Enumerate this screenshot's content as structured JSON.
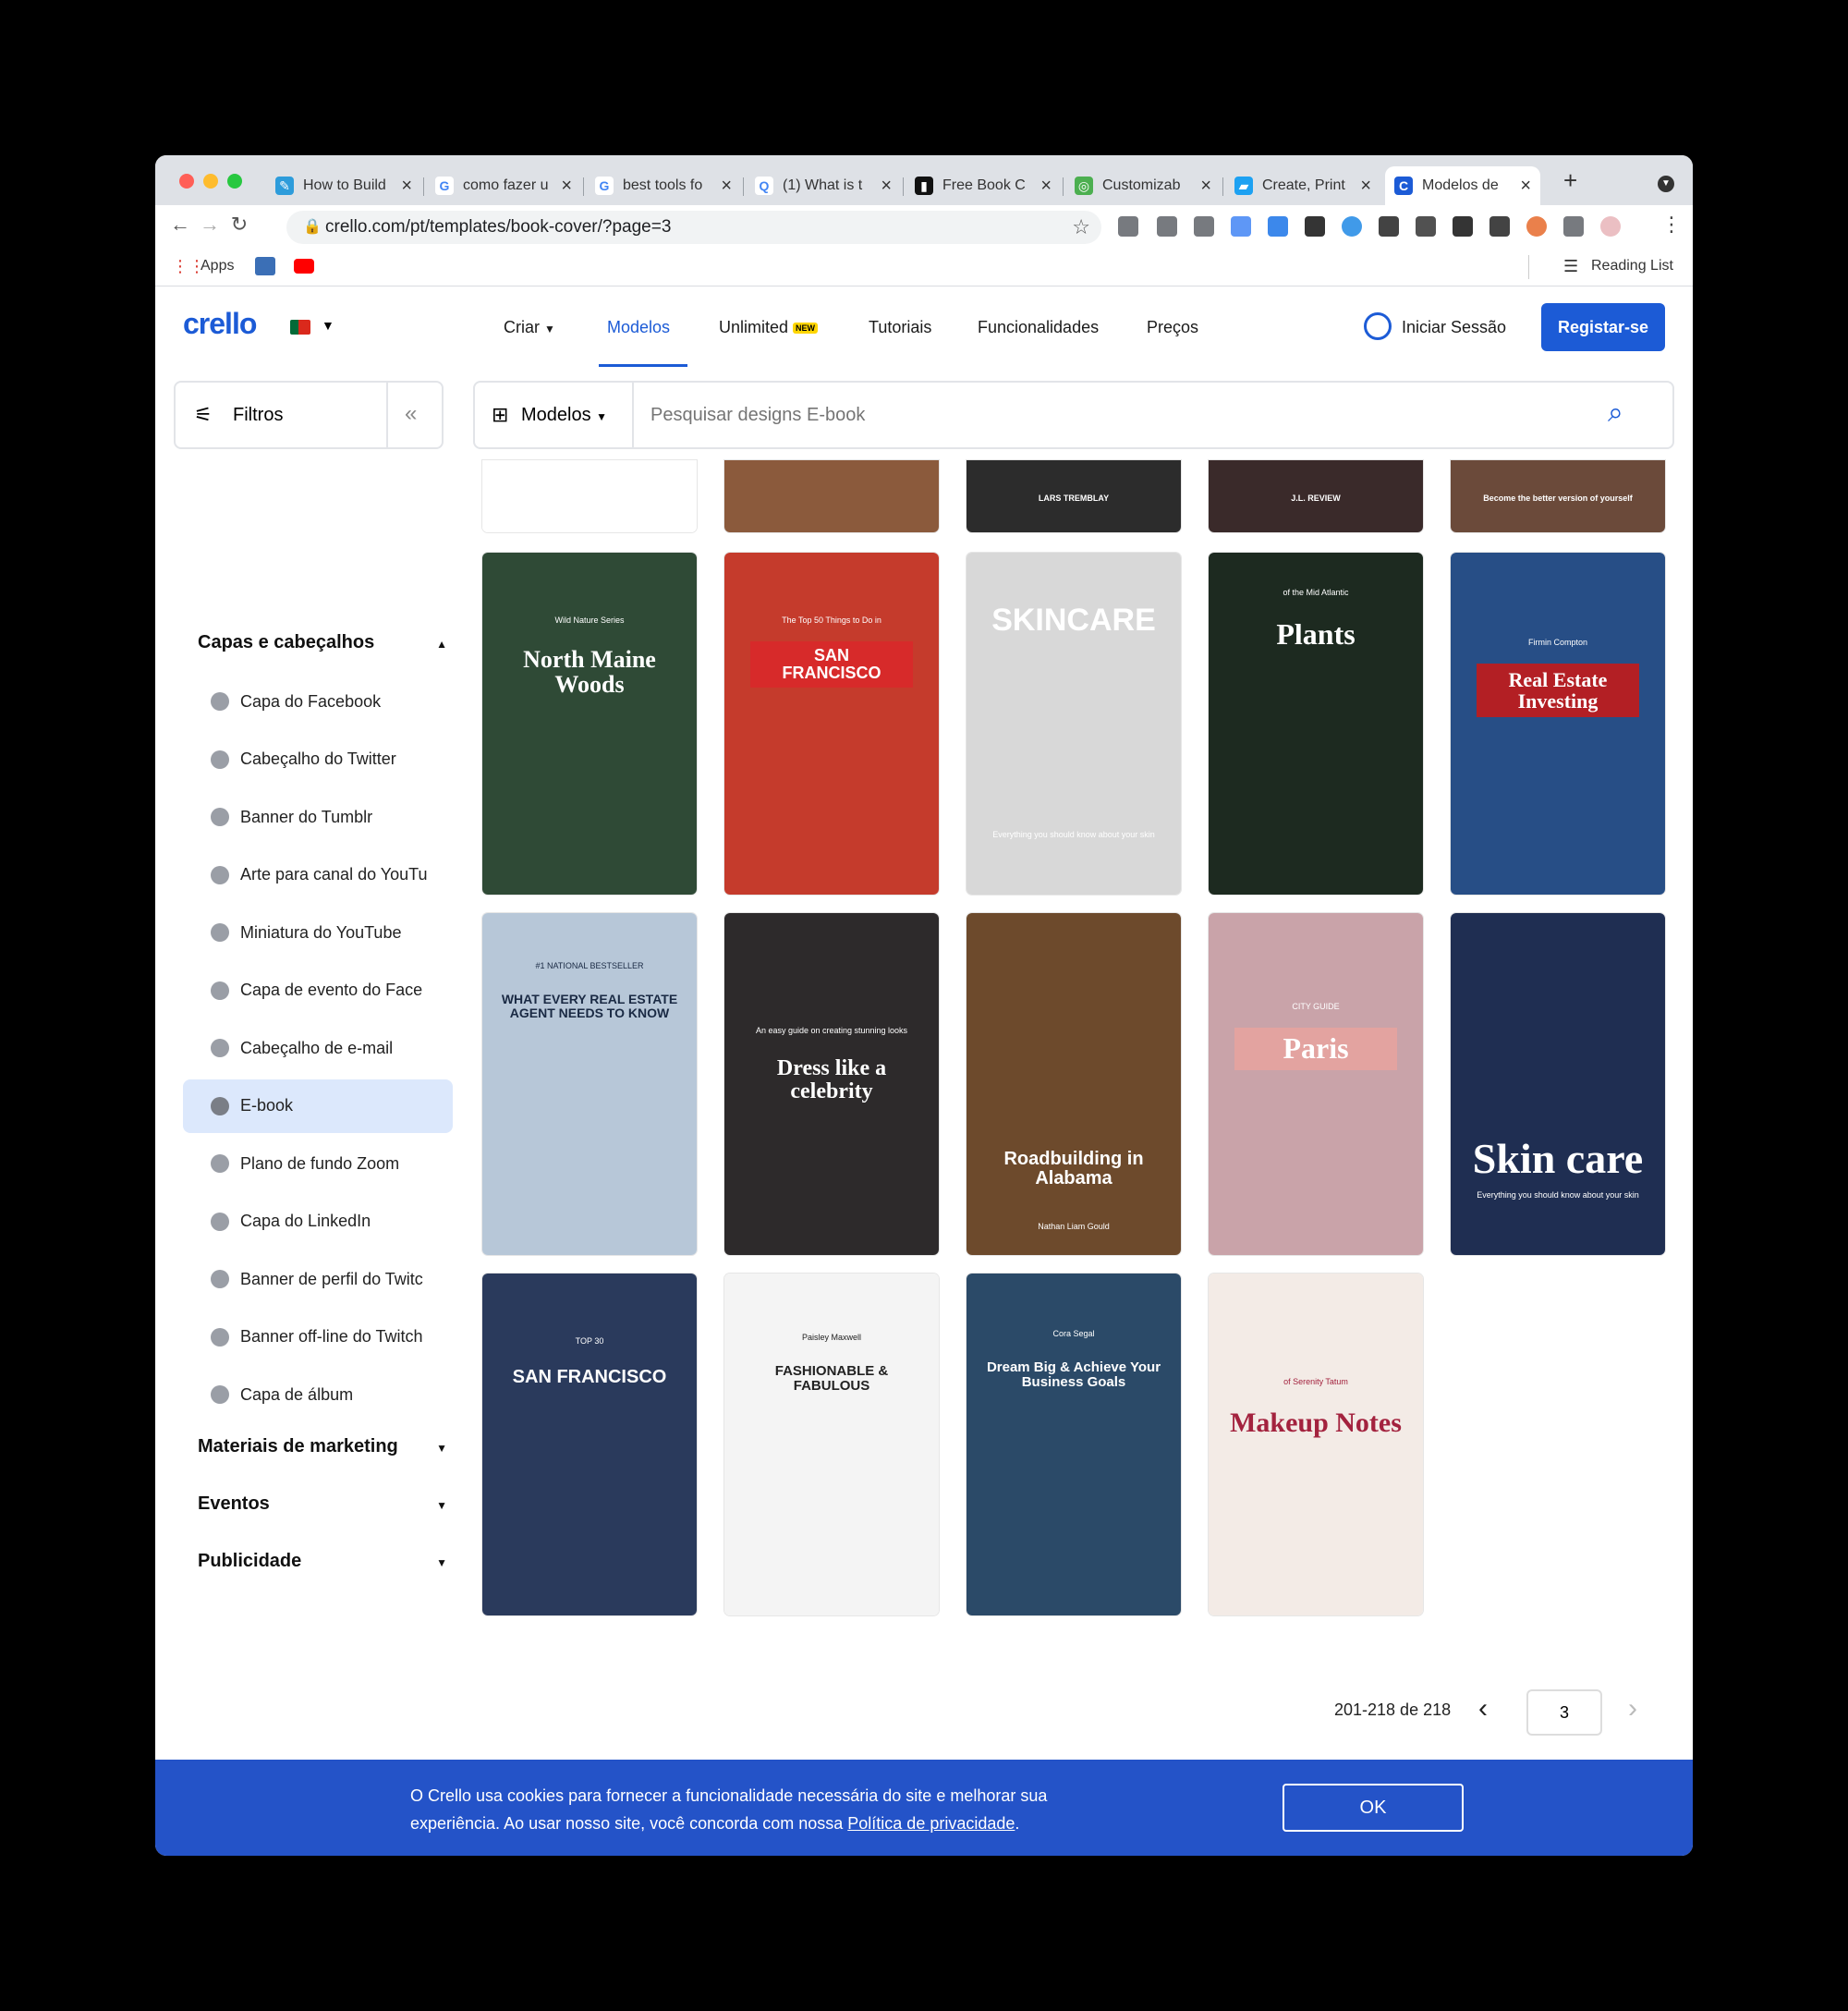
{
  "browser": {
    "tabs": [
      {
        "title": "How to Build",
        "fav": "#2d9cdb",
        "glyph": "✎"
      },
      {
        "title": "como fazer u",
        "fav": "#ffffff",
        "glyph": "G"
      },
      {
        "title": "best tools fo",
        "fav": "#ffffff",
        "glyph": "G"
      },
      {
        "title": "(1) What is t",
        "fav": "#ffffff",
        "glyph": "Q"
      },
      {
        "title": "Free Book C",
        "fav": "#111111",
        "glyph": "▮"
      },
      {
        "title": "Customizab",
        "fav": "#4caf50",
        "glyph": "◎"
      },
      {
        "title": "Create, Print",
        "fav": "#1da1f2",
        "glyph": "▰"
      },
      {
        "title": "Modelos de",
        "fav": "#1c5bd6",
        "glyph": "C"
      }
    ],
    "url": "crello.com/pt/templates/book-cover/?page=3",
    "bookmarks": {
      "apps": "Apps",
      "reading_list": "Reading List"
    }
  },
  "site": {
    "logo": "crello",
    "nav": [
      "Criar",
      "Modelos",
      "Unlimited",
      "Tutoriais",
      "Funcionalidades",
      "Preços"
    ],
    "new_badge": "NEW",
    "login": "Iniciar Sessão",
    "register": "Registar-se"
  },
  "filters": {
    "label": "Filtros"
  },
  "sidebar": {
    "section1": "Capas e cabeçalhos",
    "items": [
      "Capa do Facebook",
      "Cabeçalho do Twitter",
      "Banner do Tumblr",
      "Arte para canal do YouTu",
      "Miniatura do YouTube",
      "Capa de evento do Face",
      "Cabeçalho de e-mail",
      "E-book",
      "Plano de fundo Zoom",
      "Capa do LinkedIn",
      "Banner de perfil do Twitc",
      "Banner off-line do Twitch",
      "Capa de álbum"
    ],
    "sections": [
      "Materiais de marketing",
      "Eventos",
      "Publicidade"
    ]
  },
  "search": {
    "type_label": "Modelos",
    "placeholder": "Pesquisar designs E-book"
  },
  "grid": {
    "top_partial": [
      "",
      "",
      "LARS TREMBLAY",
      "J.L. REVIEW",
      "Become the better version of yourself"
    ],
    "cards": [
      {
        "title": "North Maine Woods",
        "sub": "Wild Nature Series",
        "bg": "#2f4a36"
      },
      {
        "title": "SAN FRANCISCO",
        "sub": "The Top 50 Things to Do in",
        "bg": "#c53b2c"
      },
      {
        "title": "SKINCARE",
        "sub": "Everything you should know about your skin",
        "bg": "#d8d8d8"
      },
      {
        "title": "Plants",
        "sub": "of the Mid Atlantic",
        "bg": "#1d2a20"
      },
      {
        "title": "Real Estate Investing",
        "sub": "Firmin Compton",
        "bg": "#274e86"
      },
      {
        "title": "WHAT EVERY REAL ESTATE AGENT NEEDS TO KNOW",
        "sub": "#1 NATIONAL BESTSELLER",
        "bg": "#b7c7d8"
      },
      {
        "title": "Dress like a celebrity",
        "sub": "An easy guide on creating stunning looks",
        "bg": "#2d2a2b"
      },
      {
        "title": "Roadbuilding in Alabama",
        "sub": "Nathan Liam Gould",
        "bg": "#6d4a2c"
      },
      {
        "title": "Paris",
        "sub": "CITY GUIDE",
        "bg": "#c9a3a9"
      },
      {
        "title": "Skin care",
        "sub": "Everything you should know about your skin",
        "bg": "#1f2e52"
      },
      {
        "title": "SAN FRANCISCO",
        "sub": "TOP 30",
        "bg": "#2a3a5c"
      },
      {
        "title": "FASHIONABLE & FABULOUS",
        "sub": "Paisley Maxwell",
        "bg": "#f4f4f4"
      },
      {
        "title": "Dream Big & Achieve Your Business Goals",
        "sub": "Cora Segal",
        "bg": "#2b4a68"
      },
      {
        "title": "Makeup Notes",
        "sub": "of Serenity Tatum",
        "bg": "#f3ebe6"
      }
    ]
  },
  "pager": {
    "range": "201-218 de 218",
    "page": "3"
  },
  "cookie": {
    "text1": "O Crello usa cookies para fornecer a funcionalidade necessária do site e melhorar sua",
    "text2": "experiência. Ao usar nosso site, você concorda com nossa",
    "link": "Política de privacidade",
    "ok": "OK"
  }
}
